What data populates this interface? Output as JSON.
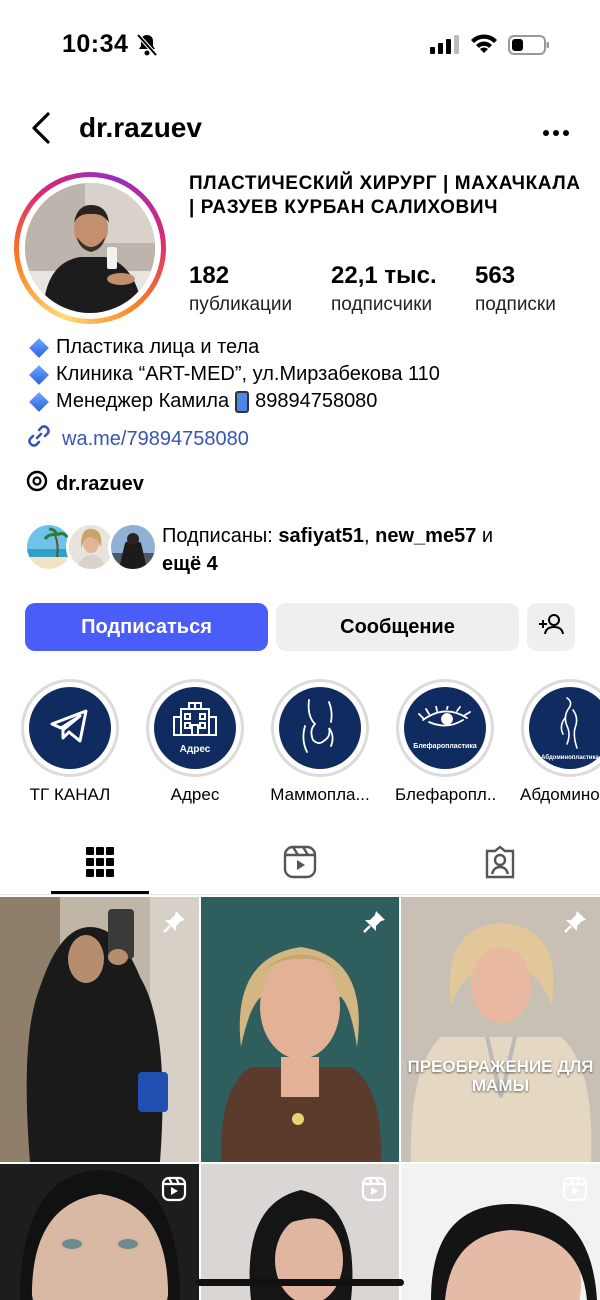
{
  "status_bar": {
    "time": "10:34"
  },
  "header": {
    "username": "dr.razuev"
  },
  "profile": {
    "full_name": "ПЛАСТИЧЕСКИЙ ХИРУРГ | МАХАЧКАЛА | РАЗУЕВ КУРБАН САЛИХОВИЧ",
    "stats": [
      {
        "value": "182",
        "label": "публикации"
      },
      {
        "value": "22,1 тыс.",
        "label": "подписчики"
      },
      {
        "value": "563",
        "label": "подписки"
      }
    ],
    "bio": {
      "line1": "Пластика лица и тела",
      "line2": "Клиника “ART-MED”, ул.Мирзабекова 110",
      "line3a": "Менеджер Камила",
      "line3b": "89894758080"
    },
    "link": "wa.me/79894758080",
    "threads_handle": "dr.razuev",
    "followed_by": {
      "prefix": "Подписаны: ",
      "user1": "safiyat51",
      "sep": ", ",
      "user2": "new_me57",
      "and": " и",
      "more": "ещё 4"
    }
  },
  "actions": {
    "follow": "Подписаться",
    "message": "Сообщение"
  },
  "highlights": [
    {
      "label": "ТГ КАНАЛ",
      "icon": "telegram-icon"
    },
    {
      "label": "Адрес",
      "icon": "building-icon",
      "inner": "Адрес"
    },
    {
      "label": "Маммопла...",
      "icon": "body-outline-icon"
    },
    {
      "label": "Блефаропл...",
      "icon": "eye-icon",
      "inner": "Блефаропластика"
    },
    {
      "label": "Абдоминоп",
      "icon": "torso-outline-icon",
      "inner": "Абдоминопластика"
    }
  ],
  "tabs": [
    {
      "name": "grid",
      "icon": "grid-icon",
      "active": true
    },
    {
      "name": "reels",
      "icon": "reels-icon",
      "active": false
    },
    {
      "name": "tagged",
      "icon": "tagged-icon",
      "active": false
    }
  ],
  "posts": [
    {
      "badge": "pin-icon"
    },
    {
      "badge": "pin-icon"
    },
    {
      "badge": "pin-icon",
      "overlay": "ПРЕОБРАЖЕНИЕ ДЛЯ МАМЫ"
    },
    {
      "badge": "reels-icon"
    },
    {
      "badge": "reels-icon"
    },
    {
      "badge": "reels-icon"
    }
  ],
  "colors": {
    "follow_button": "#4a5df9",
    "link": "#3a54b4",
    "highlight_bg": "#0f2b5f"
  }
}
